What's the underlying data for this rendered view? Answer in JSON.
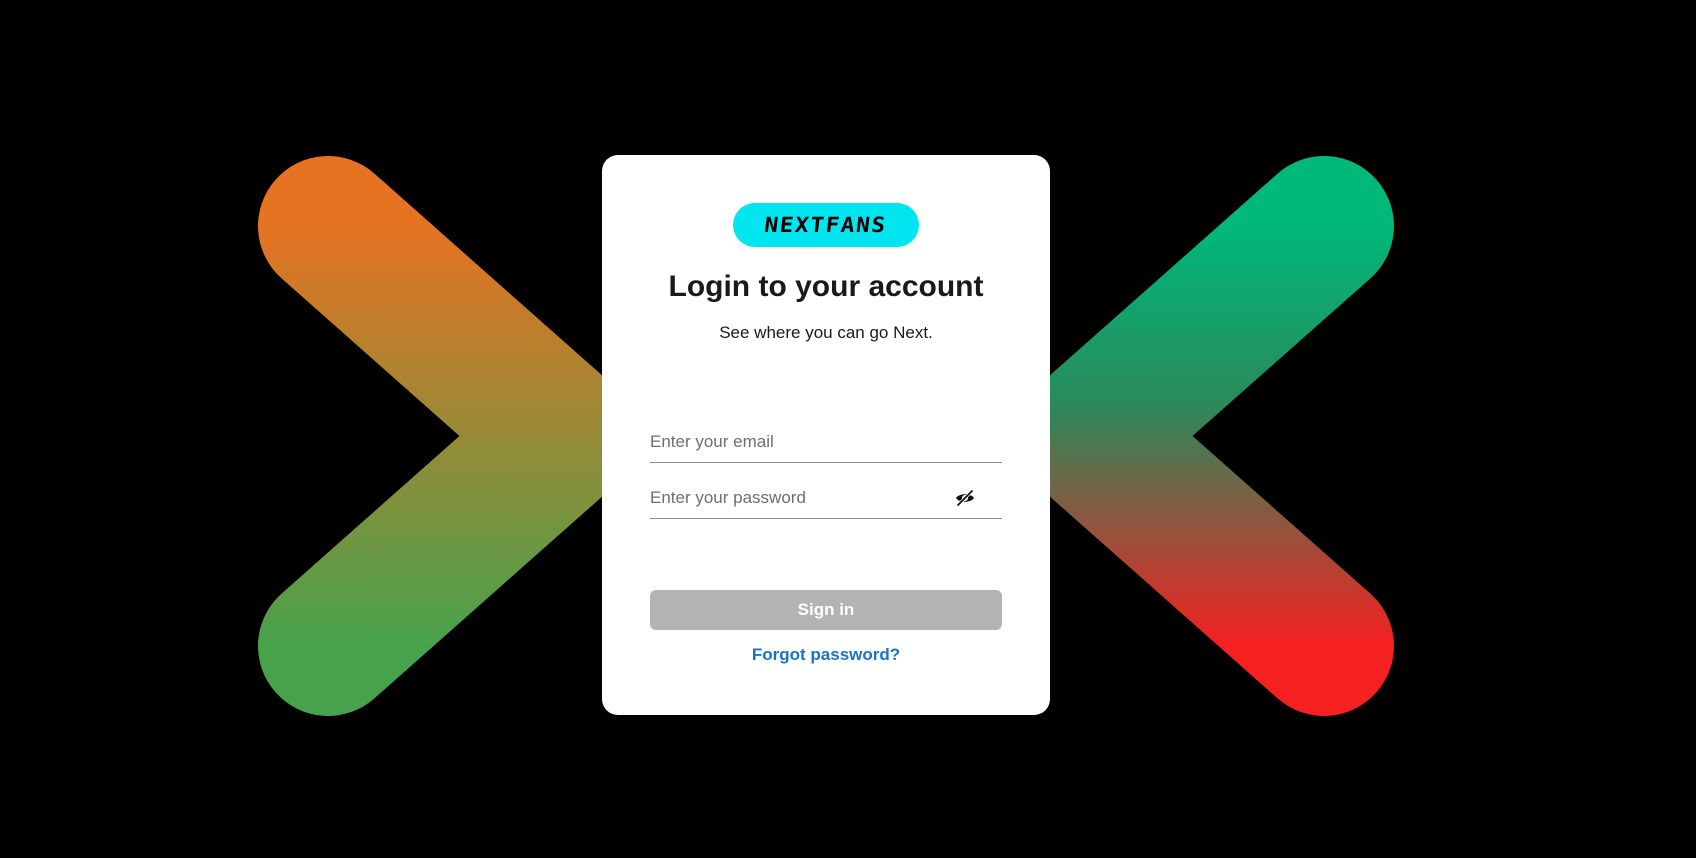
{
  "brand": {
    "logo_text": "NEXTFANS",
    "logo_color": "#00e5f0"
  },
  "login": {
    "title": "Login to your account",
    "subtitle": "See where you can go Next.",
    "email_placeholder": "Enter your email",
    "email_value": "",
    "password_placeholder": "Enter your password",
    "password_value": "",
    "password_toggle_icon": "eye-slash-icon",
    "signin_label": "Sign in",
    "forgot_label": "Forgot password?"
  },
  "colors": {
    "background": "#000000",
    "card": "#ffffff",
    "button_disabled": "#b3b3b3",
    "link": "#1a73c4",
    "left_chevron_gradient": [
      "#e57322",
      "#48a24c"
    ],
    "right_chevron_gradient": [
      "#00b87a",
      "#f52020"
    ]
  }
}
